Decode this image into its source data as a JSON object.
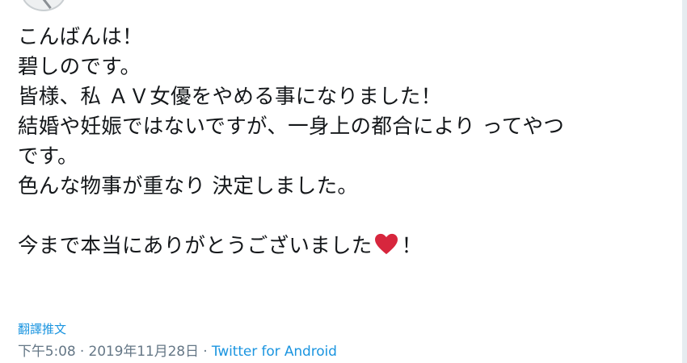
{
  "tweet": {
    "lines": [
      "こんばんは！",
      "碧しのです。",
      "皆様、私 ＡＶ女優をやめる事になりました！",
      "結婚や妊娠ではないですが、一身上の都合により ってやつ",
      "です。",
      "色んな物事が重なり 決定しました。",
      "",
      "今まで本当にありがとうございました"
    ],
    "closing_suffix": "！",
    "heart_icon": "red-heart-icon",
    "heart_color": "#d7263d"
  },
  "translate": {
    "label": "翻譯推文"
  },
  "meta": {
    "time": "下午5:08",
    "separator1": " · ",
    "date": "2019年11月28日",
    "separator2": " · ",
    "source": "Twitter for Android"
  },
  "colors": {
    "text": "#14171a",
    "link": "#1b95e0",
    "meta": "#657786"
  }
}
